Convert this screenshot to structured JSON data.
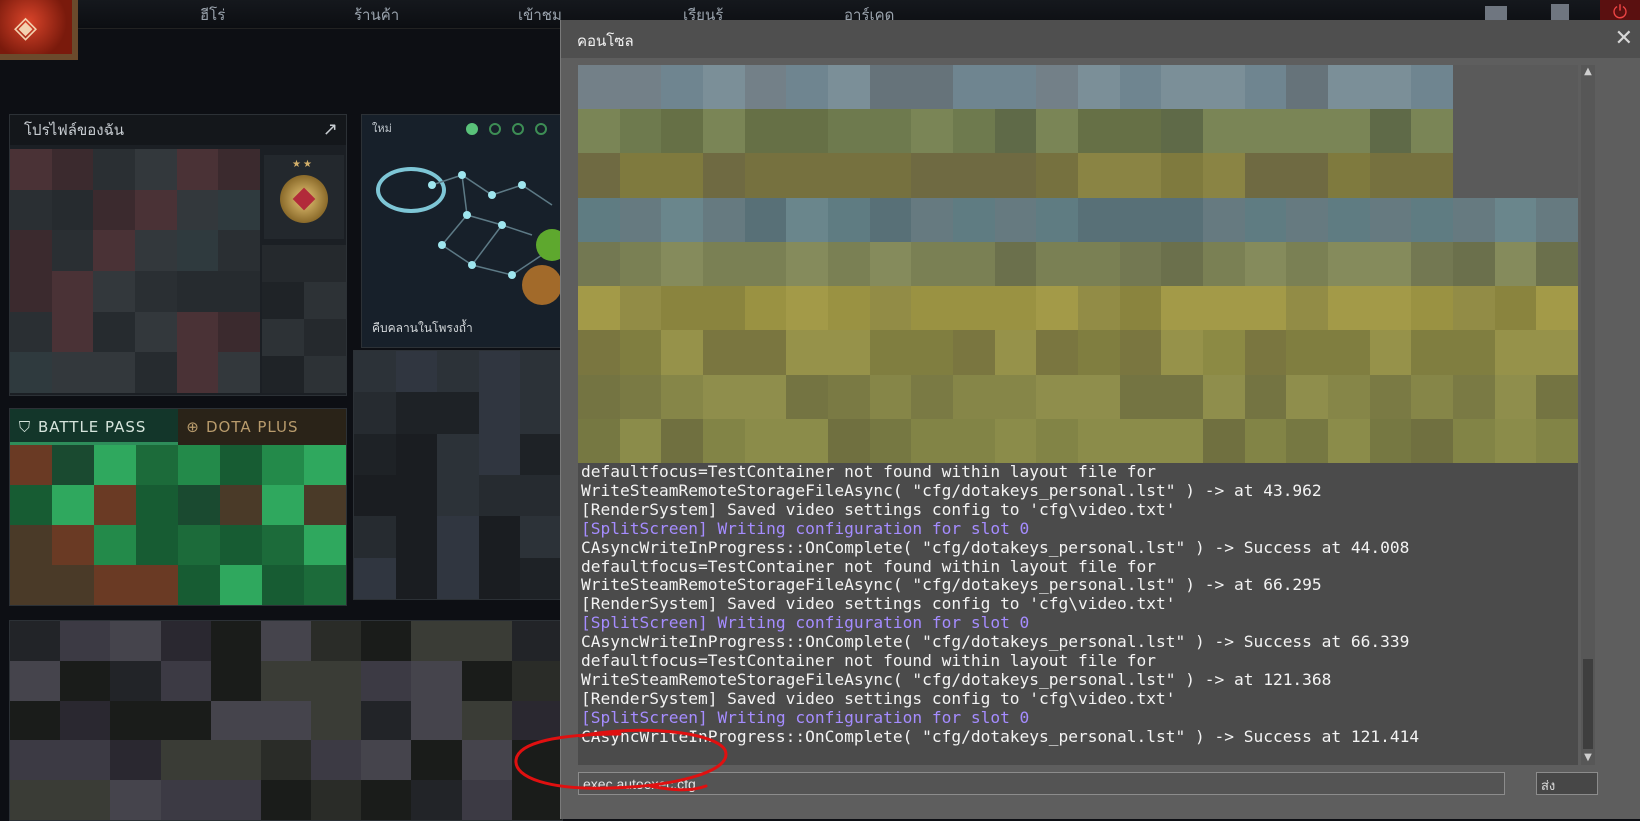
{
  "nav": {
    "items": [
      "ฮีโร่",
      "ร้านค้า",
      "เข้าชม",
      "เรียนรู้",
      "อาร์เคด"
    ],
    "icons": [
      "mail-icon",
      "profile-icon",
      "power-icon"
    ]
  },
  "profile": {
    "title": "โปรไฟล์ของฉัน",
    "rank_stars": "★★"
  },
  "news": {
    "badge": "ใหม่",
    "caption": "คืบคลานในโพรงถ้ำ"
  },
  "battlepass": {
    "tab_battle": "BATTLE PASS",
    "tab_plus": "DOTA PLUS"
  },
  "console": {
    "title": "คอนโซล",
    "log": [
      {
        "text": "defaultfocus=TestContainer not found within layout file for",
        "color": "white"
      },
      {
        "text": "WriteSteamRemoteStorageFileAsync( \"cfg/dotakeys_personal.lst\" ) -> at 43.962",
        "color": "white"
      },
      {
        "text": "[RenderSystem] Saved video settings config to 'cfg\\video.txt'",
        "color": "white"
      },
      {
        "text": "[SplitScreen] Writing configuration for slot 0",
        "color": "purple"
      },
      {
        "text": "CAsyncWriteInProgress::OnComplete( \"cfg/dotakeys_personal.lst\" ) -> Success at 44.008",
        "color": "white"
      },
      {
        "text": "defaultfocus=TestContainer not found within layout file for",
        "color": "white"
      },
      {
        "text": "WriteSteamRemoteStorageFileAsync( \"cfg/dotakeys_personal.lst\" ) -> at 66.295",
        "color": "white"
      },
      {
        "text": "[RenderSystem] Saved video settings config to 'cfg\\video.txt'",
        "color": "white"
      },
      {
        "text": "[SplitScreen] Writing configuration for slot 0",
        "color": "purple"
      },
      {
        "text": "CAsyncWriteInProgress::OnComplete( \"cfg/dotakeys_personal.lst\" ) -> Success at 66.339",
        "color": "white"
      },
      {
        "text": "defaultfocus=TestContainer not found within layout file for",
        "color": "white"
      },
      {
        "text": "WriteSteamRemoteStorageFileAsync( \"cfg/dotakeys_personal.lst\" ) -> at 121.368",
        "color": "white"
      },
      {
        "text": "[RenderSystem] Saved video settings config to 'cfg\\video.txt'",
        "color": "white"
      },
      {
        "text": "[SplitScreen] Writing configuration for slot 0",
        "color": "purple"
      },
      {
        "text": "CAsyncWriteInProgress::OnComplete( \"cfg/dotakeys_personal.lst\" ) -> Success at 121.414",
        "color": "white"
      }
    ],
    "input_value": "exec autoexec.cfg",
    "submit_label": "ส่ง"
  },
  "colors": {
    "console_bg": "#5e5e5e",
    "log_white": "#f3f3f3",
    "log_purple": "#a58cff",
    "annotation_red": "#e01010"
  }
}
